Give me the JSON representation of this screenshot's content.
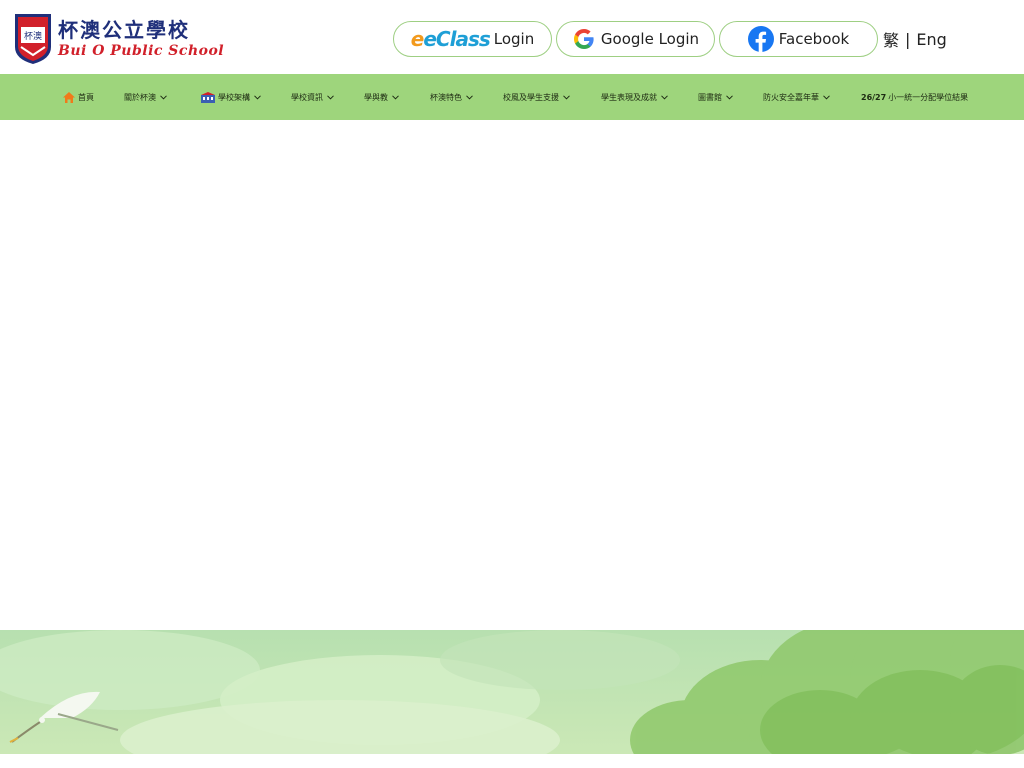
{
  "header": {
    "logo": {
      "name_zh": "杯澳公立學校",
      "name_en": "Bui O Public School",
      "crest_text": "杯澳"
    },
    "buttons": [
      {
        "brand": "eClass",
        "label": "Login",
        "icon": "eclass-logo"
      },
      {
        "label": "Google Login",
        "icon": "google-icon"
      },
      {
        "label": "Facebook",
        "icon": "facebook-icon"
      }
    ],
    "language": {
      "traditional": "繁",
      "separator": "|",
      "english": "Eng"
    }
  },
  "nav": {
    "items": [
      {
        "label": "首頁",
        "icon": "home-icon",
        "has_dropdown": false
      },
      {
        "label": "關於杯澳",
        "has_dropdown": true
      },
      {
        "label": "學校架構",
        "icon": "school-building-icon",
        "has_dropdown": true
      },
      {
        "label": "學校資訊",
        "has_dropdown": true
      },
      {
        "label": "學與教",
        "has_dropdown": true
      },
      {
        "label": "杯澳特色",
        "has_dropdown": true
      },
      {
        "label": "校風及學生支援",
        "has_dropdown": true
      },
      {
        "label": "學生表現及成就",
        "has_dropdown": true
      },
      {
        "label": "圖書館",
        "has_dropdown": true
      },
      {
        "label": "防火安全嘉年華",
        "has_dropdown": true
      },
      {
        "label_prefix": "26/27",
        "label": "小一統一分配學位結果",
        "has_dropdown": false
      }
    ]
  },
  "colors": {
    "nav_background": "#9ed57c",
    "button_border": "#9ecf83",
    "logo_blue": "#1f2f7a",
    "logo_red": "#d1202a",
    "banner_tint": "#cfe9b8"
  }
}
